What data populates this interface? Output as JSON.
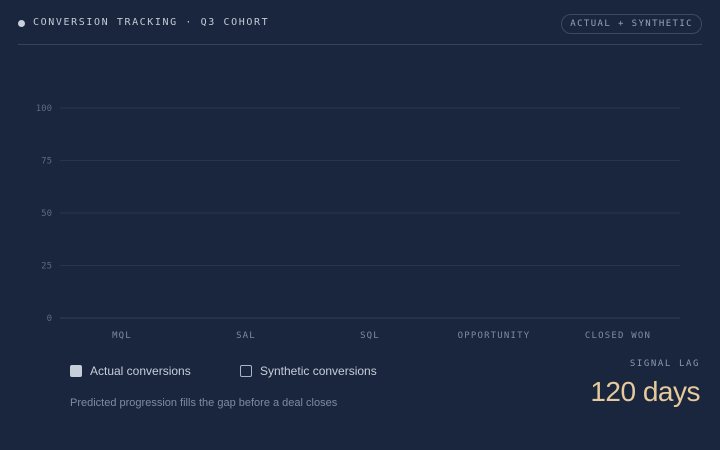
{
  "header": {
    "title": "CONVERSION TRACKING · Q3 COHORT",
    "badge": "ACTUAL + SYNTHETIC"
  },
  "chart_data": {
    "type": "bar",
    "categories": [
      "MQL",
      "SAL",
      "SQL",
      "OPPORTUNITY",
      "CLOSED WON"
    ],
    "series": [
      {
        "name": "Actual conversions",
        "values": [
          0,
          0,
          0,
          0,
          0
        ]
      },
      {
        "name": "Synthetic conversions",
        "values": [
          0,
          0,
          0,
          0,
          0
        ]
      }
    ],
    "yticks": [
      0,
      25,
      50,
      75,
      100
    ],
    "ylim": [
      0,
      100
    ],
    "grid": true,
    "title": "",
    "xlabel": "",
    "ylabel": ""
  },
  "legend": {
    "actual_label": "Actual conversions",
    "synthetic_label": "Synthetic conversions"
  },
  "caption": "Predicted progression fills the gap before a deal closes",
  "signal_lag": {
    "label": "SIGNAL LAG",
    "value": "120 days"
  },
  "colors": {
    "background": "#19263d",
    "actual": "#c7ceda",
    "synthetic": "#a9b4c6",
    "accent": "#e6c99c"
  }
}
